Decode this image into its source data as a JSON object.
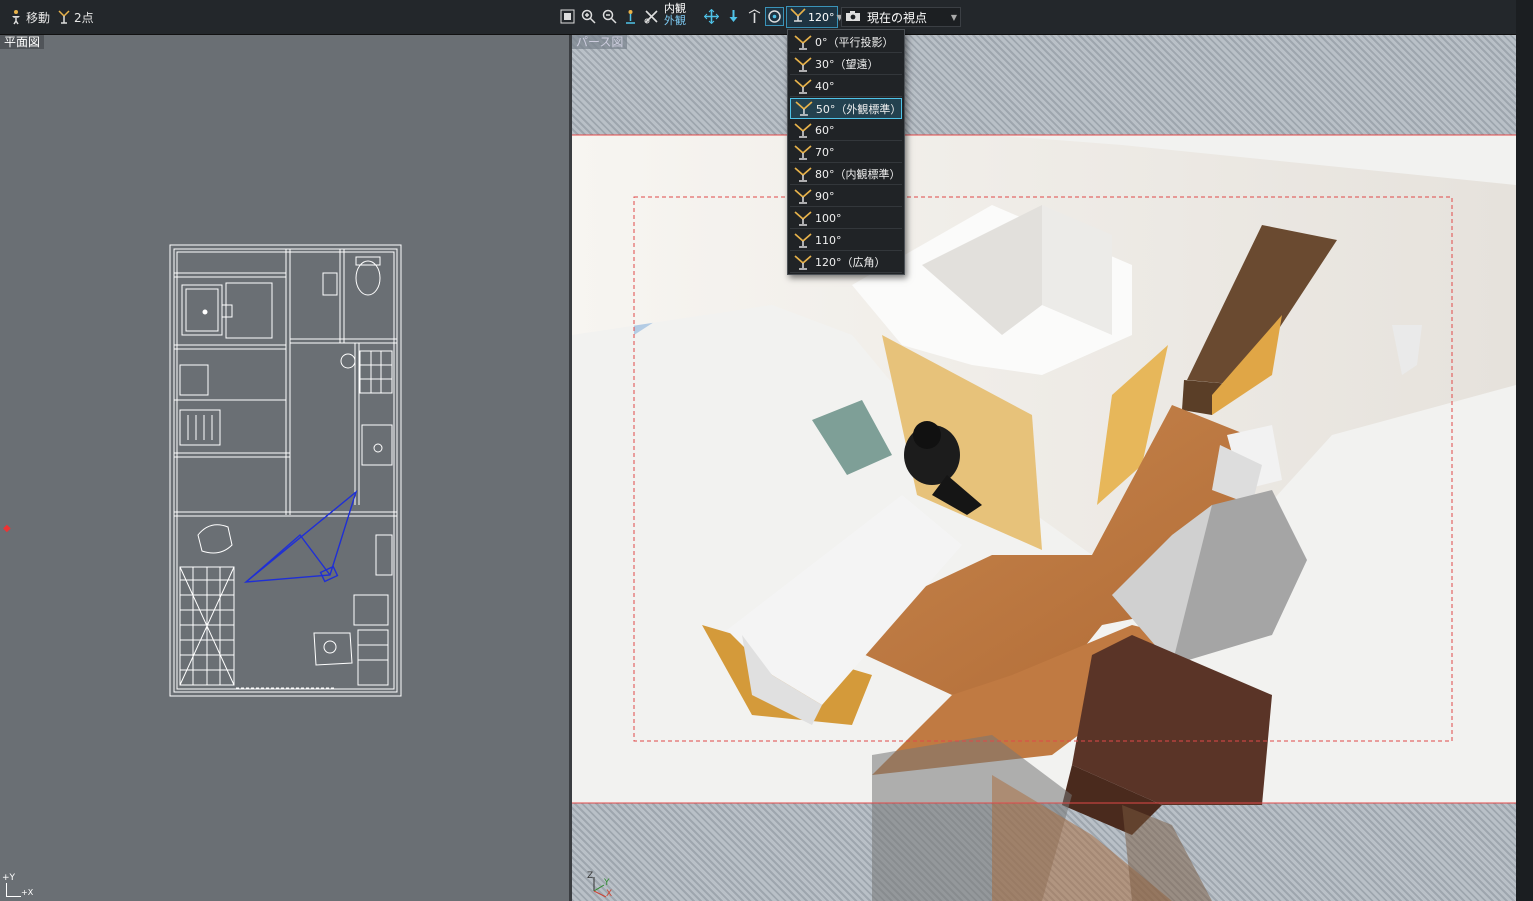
{
  "toolbar": {
    "move_label": "移動",
    "two_point_label": "2点",
    "view_inner": "内観",
    "view_outer": "外観",
    "fov_value": "120°",
    "viewpoint_select": "現在の視点"
  },
  "panels": {
    "plan_label": "平面図",
    "perspective_label": "パース図"
  },
  "fov_menu": {
    "items": [
      "0°（平行投影）",
      "30°（望遠）",
      "40°",
      "50°（外観標準）",
      "60°",
      "70°",
      "80°（内観標準）",
      "90°",
      "100°",
      "110°",
      "120°（広角）"
    ],
    "selected_index": 3
  },
  "axes": {
    "plan_y": "+Y",
    "plan_x": "+X",
    "persp_z": "Z",
    "persp_y": "Y",
    "persp_x": "X"
  },
  "colors": {
    "accent": "#4fc3e8",
    "camera_line": "#1f2fd6",
    "safe_frame": "#e04848"
  }
}
